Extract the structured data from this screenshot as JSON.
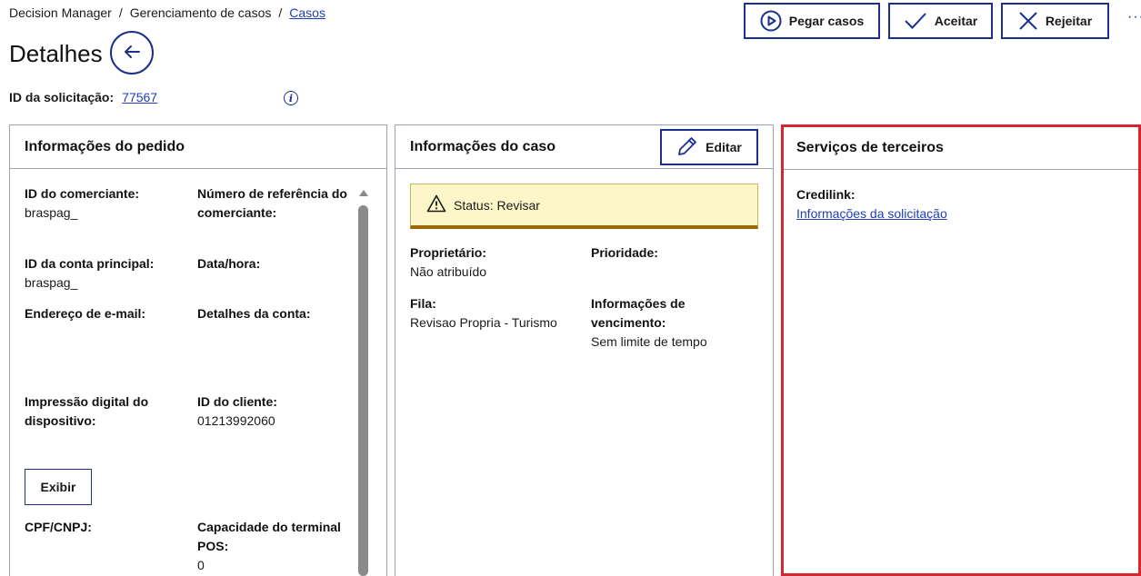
{
  "breadcrumb": {
    "item1": "Decision Manager",
    "sep1": "/",
    "item2": "Gerenciamento de casos",
    "sep2": "/",
    "item3": "Casos"
  },
  "actions": {
    "pegar": "Pegar casos",
    "aceitar": "Aceitar",
    "rejeitar": "Rejeitar",
    "more": "···"
  },
  "page": {
    "title": "Detalhes"
  },
  "request": {
    "label": "ID da solicitação:",
    "id": "77567",
    "info_icon": "i"
  },
  "pedido": {
    "title": "Informações do pedido",
    "merchant_id_label": "ID do comerciante:",
    "merchant_id_value": "braspag_",
    "merchant_ref_label": "Número de referência do comerciante:",
    "main_account_label": "ID da conta principal:",
    "main_account_value": "braspag_",
    "datetime_label": "Data/hora:",
    "email_label": "Endereço de e-mail:",
    "account_details_label": "Detalhes da conta:",
    "device_label": "Impressão digital do dispositivo:",
    "client_id_label": "ID do cliente:",
    "client_id_value": "01213992060",
    "exibir_button": "Exibir",
    "cpf_label": "CPF/CNPJ:",
    "pos_label": "Capacidade do terminal POS:",
    "pos_value": "0"
  },
  "caso": {
    "title": "Informações do caso",
    "edit_button": "Editar",
    "status": "Status: Revisar",
    "owner_label": "Proprietário:",
    "owner_value": "Não atribuído",
    "priority_label": "Prioridade:",
    "queue_label": "Fila:",
    "queue_value": "Revisao Propria - Turismo",
    "due_label": "Informações de vencimento:",
    "due_value": "Sem limite de tempo"
  },
  "terceiros": {
    "title": "Serviços de terceiros",
    "credilink_label": "Credilink:",
    "credilink_link": "Informações da solicitação"
  },
  "colors": {
    "brand": "#1b2f8f",
    "link": "#1f3fb5",
    "highlight": "#d7262d",
    "status_bg": "#fdf6c8",
    "status_border": "#9a6a00"
  }
}
